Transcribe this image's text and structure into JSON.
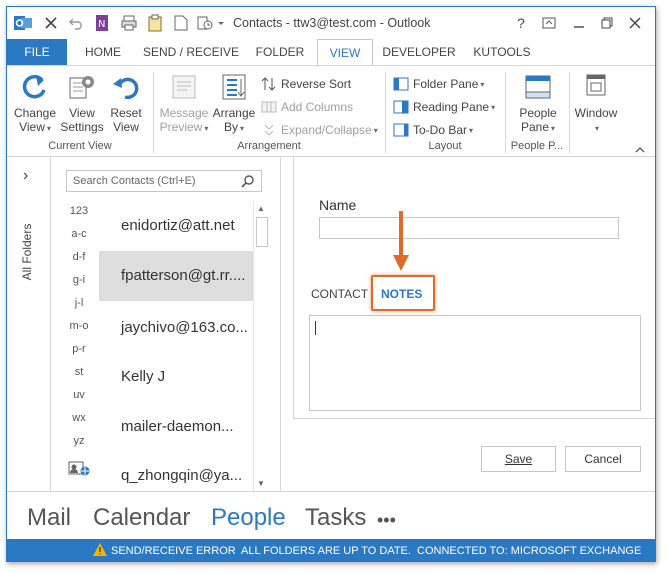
{
  "window": {
    "title": "Contacts - ttw3@test.com - Outlook",
    "controls": {
      "help": "?",
      "restore": "❐"
    }
  },
  "tabs": [
    {
      "label": "FILE"
    },
    {
      "label": "HOME"
    },
    {
      "label": "SEND / RECEIVE"
    },
    {
      "label": "FOLDER"
    },
    {
      "label": "VIEW"
    },
    {
      "label": "DEVELOPER"
    },
    {
      "label": "KUTOOLS"
    }
  ],
  "ribbon": {
    "current_view": {
      "label": "Current View",
      "change_view": [
        "Change",
        "View"
      ],
      "view_settings": [
        "View",
        "Settings"
      ],
      "reset_view": [
        "Reset",
        "View"
      ]
    },
    "arrangement": {
      "label": "Arrangement",
      "message_preview": [
        "Message",
        "Preview"
      ],
      "arrange_by": [
        "Arrange",
        "By"
      ],
      "reverse_sort": "Reverse Sort",
      "add_columns": "Add Columns",
      "expand_collapse": "Expand/Collapse"
    },
    "layout": {
      "label": "Layout",
      "folder_pane": "Folder Pane",
      "reading_pane": "Reading Pane",
      "todo_bar": "To-Do Bar"
    },
    "people_pane": {
      "label": "People P...",
      "button": [
        "People",
        "Pane"
      ]
    },
    "window": {
      "label": "Window"
    }
  },
  "left_nav": {
    "all_folders": "All Folders",
    "expand": "›"
  },
  "search": {
    "placeholder": "Search Contacts (Ctrl+E)"
  },
  "index": [
    "123",
    "a-c",
    "d-f",
    "g-i",
    "j-l",
    "m-o",
    "p-r",
    "st",
    "uv",
    "wx",
    "yz"
  ],
  "contacts": [
    {
      "name": "enidortiz@att.net"
    },
    {
      "name": "fpatterson@gt.rr...."
    },
    {
      "name": "jaychivo@163.co..."
    },
    {
      "name": "Kelly J"
    },
    {
      "name": "mailer-daemon..."
    },
    {
      "name": "q_zhongqin@ya..."
    }
  ],
  "reading_pane": {
    "name_label": "Name",
    "name_value": "",
    "tab_contact": "CONTACT",
    "tab_notes": "NOTES",
    "save": "Save",
    "cancel": "Cancel"
  },
  "bottom_nav": [
    "Mail",
    "Calendar",
    "People",
    "Tasks",
    "•••"
  ],
  "status": {
    "error": "SEND/RECEIVE ERROR",
    "folders": "ALL FOLDERS ARE UP TO DATE.",
    "connection": "CONNECTED TO: MICROSOFT EXCHANGE"
  },
  "colors": {
    "accent": "#2b79c2",
    "highlight": "#e06a2b",
    "selected_row": "#dedede",
    "warning": "#f2b600"
  }
}
